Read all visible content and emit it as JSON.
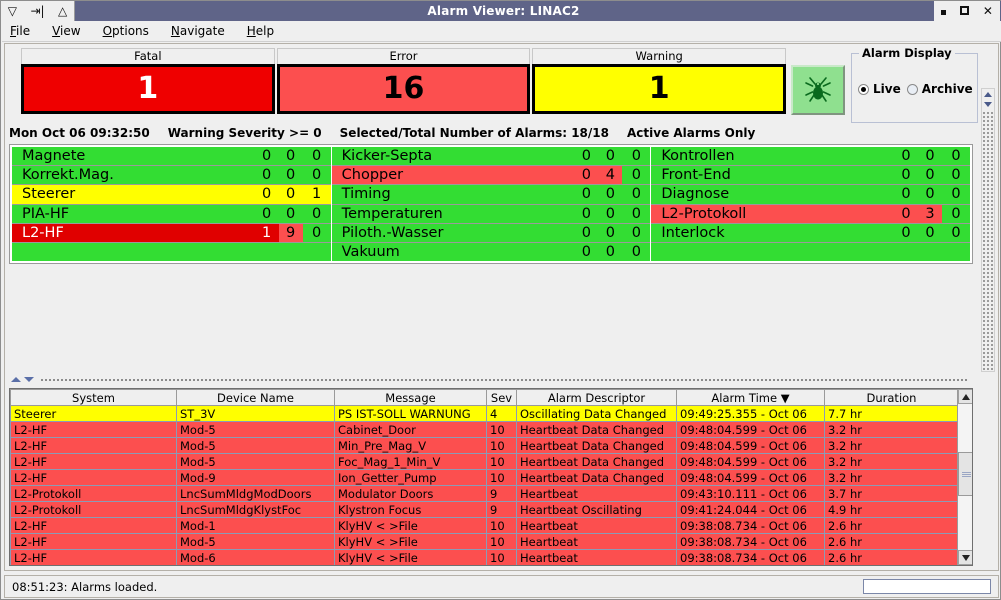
{
  "window": {
    "title": "Alarm Viewer:  LINAC2",
    "decorations": [
      "menu-icon",
      "iconify-icon",
      "shade-icon"
    ],
    "buttons": [
      "minimize",
      "maximize",
      "close"
    ]
  },
  "menubar": {
    "items": [
      {
        "label": "File",
        "mnemonic": "F"
      },
      {
        "label": "View",
        "mnemonic": "V"
      },
      {
        "label": "Options",
        "mnemonic": "O"
      },
      {
        "label": "Navigate",
        "mnemonic": "N"
      },
      {
        "label": "Help",
        "mnemonic": "H"
      }
    ]
  },
  "summary": {
    "counters": [
      {
        "label": "Fatal",
        "value": "1",
        "style": "fatal"
      },
      {
        "label": "Error",
        "value": "16",
        "style": "error"
      },
      {
        "label": "Warning",
        "value": "1",
        "style": "warning"
      }
    ],
    "spider_icon": "spider-icon"
  },
  "alarm_display": {
    "legend": "Alarm Display",
    "options": [
      {
        "label": "Live",
        "selected": true
      },
      {
        "label": "Archive",
        "selected": false
      }
    ]
  },
  "status_line": {
    "timestamp": "Mon Oct 06 09:32:50",
    "severity": "Warning Severity >= 0",
    "counts": "Selected/Total Number of Alarms: 18/18",
    "filter": "Active Alarms Only"
  },
  "groups": {
    "columns": [
      [
        {
          "name": "Magnete",
          "values": [
            "0",
            "0",
            "0"
          ],
          "name_color": "green",
          "cell_colors": [
            "green",
            "green",
            "green"
          ]
        },
        {
          "name": "Korrekt.Mag.",
          "values": [
            "0",
            "0",
            "0"
          ],
          "name_color": "green",
          "cell_colors": [
            "green",
            "green",
            "green"
          ]
        },
        {
          "name": "Steerer",
          "values": [
            "0",
            "0",
            "1"
          ],
          "name_color": "yellow",
          "cell_colors": [
            "yellow",
            "yellow",
            "yellow"
          ]
        },
        {
          "name": "PIA-HF",
          "values": [
            "0",
            "0",
            "0"
          ],
          "name_color": "green",
          "cell_colors": [
            "green",
            "green",
            "green"
          ]
        },
        {
          "name": "L2-HF",
          "values": [
            "1",
            "9",
            "0"
          ],
          "name_color": "dred",
          "cell_colors": [
            "dred",
            "red",
            "green"
          ]
        },
        {
          "name": "",
          "values": [
            "",
            "",
            ""
          ],
          "name_color": "green",
          "cell_colors": [
            "green",
            "green",
            "green"
          ]
        }
      ],
      [
        {
          "name": "Kicker-Septa",
          "values": [
            "0",
            "0",
            "0"
          ],
          "name_color": "green",
          "cell_colors": [
            "green",
            "green",
            "green"
          ]
        },
        {
          "name": "Chopper",
          "values": [
            "0",
            "4",
            "0"
          ],
          "name_color": "red",
          "cell_colors": [
            "red",
            "red",
            "green"
          ]
        },
        {
          "name": "Timing",
          "values": [
            "0",
            "0",
            "0"
          ],
          "name_color": "green",
          "cell_colors": [
            "green",
            "green",
            "green"
          ]
        },
        {
          "name": "Temperaturen",
          "values": [
            "0",
            "0",
            "0"
          ],
          "name_color": "green",
          "cell_colors": [
            "green",
            "green",
            "green"
          ]
        },
        {
          "name": "Piloth.-Wasser",
          "values": [
            "0",
            "0",
            "0"
          ],
          "name_color": "green",
          "cell_colors": [
            "green",
            "green",
            "green"
          ]
        },
        {
          "name": "Vakuum",
          "values": [
            "0",
            "0",
            "0"
          ],
          "name_color": "green",
          "cell_colors": [
            "green",
            "green",
            "green"
          ]
        }
      ],
      [
        {
          "name": "Kontrollen",
          "values": [
            "0",
            "0",
            "0"
          ],
          "name_color": "green",
          "cell_colors": [
            "green",
            "green",
            "green"
          ]
        },
        {
          "name": "Front-End",
          "values": [
            "0",
            "0",
            "0"
          ],
          "name_color": "green",
          "cell_colors": [
            "green",
            "green",
            "green"
          ]
        },
        {
          "name": "Diagnose",
          "values": [
            "0",
            "0",
            "0"
          ],
          "name_color": "green",
          "cell_colors": [
            "green",
            "green",
            "green"
          ]
        },
        {
          "name": "L2-Protokoll",
          "values": [
            "0",
            "3",
            "0"
          ],
          "name_color": "red",
          "cell_colors": [
            "red",
            "red",
            "green"
          ]
        },
        {
          "name": "Interlock",
          "values": [
            "0",
            "0",
            "0"
          ],
          "name_color": "green",
          "cell_colors": [
            "green",
            "green",
            "green"
          ]
        },
        {
          "name": "",
          "values": [
            "",
            "",
            ""
          ],
          "name_color": "green",
          "cell_colors": [
            "green",
            "green",
            "green"
          ]
        }
      ]
    ]
  },
  "table": {
    "headers": [
      "System",
      "Device Name",
      "Message",
      "Sev",
      "Alarm Descriptor",
      "Alarm Time",
      "Duration"
    ],
    "sorted_column": "Alarm Time",
    "sort_indicator": "descending",
    "rows": [
      {
        "severity": "warn",
        "cells": [
          "Steerer",
          "ST_3V",
          "PS IST-SOLL WARNUNG",
          "4",
          "Oscillating Data Changed",
          "09:49:25.355 - Oct 06",
          "7.7 hr"
        ]
      },
      {
        "severity": "err",
        "cells": [
          "L2-HF",
          "Mod-5",
          "Cabinet_Door",
          "10",
          "Heartbeat Data Changed",
          "09:48:04.599 - Oct 06",
          "3.2 hr"
        ]
      },
      {
        "severity": "err",
        "cells": [
          "L2-HF",
          "Mod-5",
          "Min_Pre_Mag_V",
          "10",
          "Heartbeat Data Changed",
          "09:48:04.599 - Oct 06",
          "3.2 hr"
        ]
      },
      {
        "severity": "err",
        "cells": [
          "L2-HF",
          "Mod-5",
          "Foc_Mag_1_Min_V",
          "10",
          "Heartbeat Data Changed",
          "09:48:04.599 - Oct 06",
          "3.2 hr"
        ]
      },
      {
        "severity": "err",
        "cells": [
          "L2-HF",
          "Mod-9",
          "Ion_Getter_Pump",
          "10",
          "Heartbeat Data Changed",
          "09:48:04.599 - Oct 06",
          "3.2 hr"
        ]
      },
      {
        "severity": "err",
        "cells": [
          "L2-Protokoll",
          "LncSumMldgModDoors",
          "Modulator Doors",
          "9",
          "Heartbeat",
          "09:43:10.111 - Oct 06",
          "3.7 hr"
        ]
      },
      {
        "severity": "err",
        "cells": [
          "L2-Protokoll",
          "LncSumMldgKlystFoc",
          "Klystron Focus",
          "9",
          "Heartbeat Oscillating",
          "09:41:24.044 - Oct 06",
          "4.9 hr"
        ]
      },
      {
        "severity": "err",
        "cells": [
          "L2-HF",
          "Mod-1",
          "KlyHV < >File",
          "10",
          "Heartbeat",
          "09:38:08.734 - Oct 06",
          "2.6 hr"
        ]
      },
      {
        "severity": "err",
        "cells": [
          "L2-HF",
          "Mod-5",
          "KlyHV < >File",
          "10",
          "Heartbeat",
          "09:38:08.734 - Oct 06",
          "2.6 hr"
        ]
      },
      {
        "severity": "err",
        "cells": [
          "L2-HF",
          "Mod-6",
          "KlyHV < >File",
          "10",
          "Heartbeat",
          "09:38:08.734 - Oct 06",
          "2.6 hr"
        ]
      },
      {
        "severity": "err",
        "cells": [
          "",
          "",
          "",
          "",
          "",
          "",
          ""
        ]
      }
    ]
  },
  "bottom": {
    "status": "08:51:23: Alarms loaded.",
    "input_value": ""
  },
  "colors": {
    "fatal": "#ef0000",
    "error": "#fc4f4f",
    "warning": "#ffff00",
    "ok": "#33dd33",
    "titlebar": "#5f6488"
  }
}
